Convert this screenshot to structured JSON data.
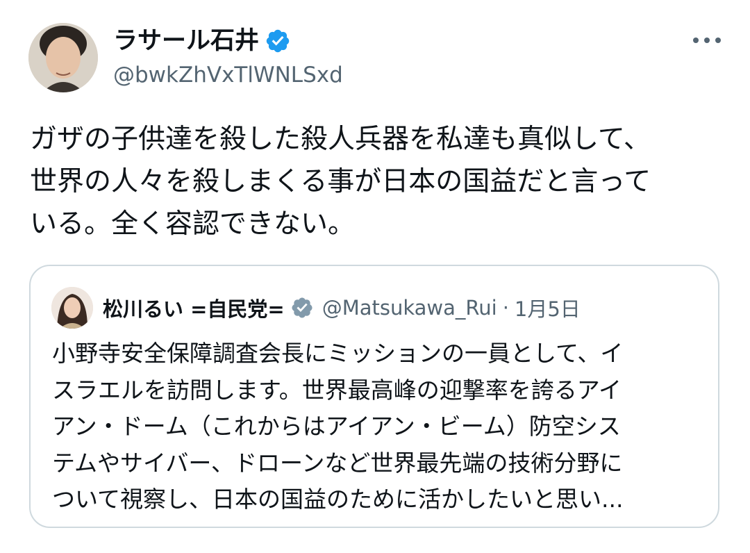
{
  "author": {
    "display_name": "ラサール石井",
    "handle": "@bwkZhVxTlWNLSxd",
    "avatar_icon": "avatar-photo",
    "verified_icon": "verified-badge-icon",
    "verified_color": "#1d9bf0"
  },
  "menu": {
    "icon": "more-options-icon"
  },
  "tweet": {
    "text": "ガザの子供達を殺した殺人兵器を私達も真似して、\n世界の人々を殺しまくる事が日本の国益だと言って\nいる。全く容認できない。"
  },
  "quoted_tweet": {
    "display_name": "松川るい =自民党=",
    "verified_icon": "gov-verified-badge-icon",
    "verified_color": "#829aab",
    "handle": "@Matsukawa_Rui",
    "separator": "·",
    "date": "1月5日",
    "text": "小野寺安全保障調査会長にミッションの一員として、イ\nスラエルを訪問します。世界最高峰の迎撃率を誇るアイ\nアン・ドーム（これからはアイアン・ビーム）防空シス\nテムやサイバー、ドローンなど世界最先端の技術分野に\nついて視察し、日本の国益のために活かしたいと思い..."
  },
  "colors": {
    "text_primary": "#0f1419",
    "text_secondary": "#536471",
    "border": "#cfd9de"
  }
}
